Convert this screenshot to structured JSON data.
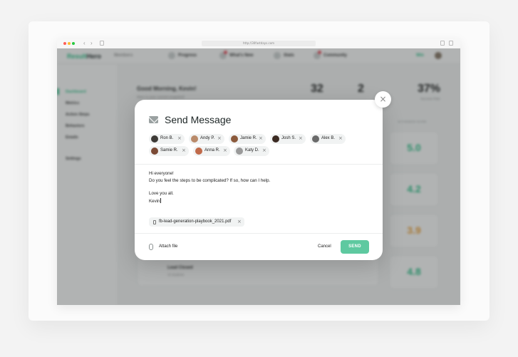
{
  "browser": {
    "url": "http://30fastdays.com",
    "traffic_colors": [
      "#ff5f57",
      "#febc2e",
      "#28c840"
    ]
  },
  "app": {
    "logo_prefix": "",
    "logo_brand": "Result",
    "logo_suffix": "Hero",
    "top_nav": [
      "Members",
      "Progress",
      "What's New",
      "Stats",
      "Community"
    ],
    "credits": "Win",
    "sidebar": [
      "Dashboard",
      "Metrics",
      "Action Steps",
      "Behaviors",
      "Emails",
      "Settings"
    ],
    "greeting": "Good Morning, Kevin!",
    "greeting_sub": "Here is your current snapshot!",
    "stats": [
      "32",
      "2",
      "37%"
    ],
    "stat_caption": "Success Rate",
    "column_header": "ACTIVENESS SCORE",
    "scores": [
      {
        "value": "5.0",
        "color": "#32c48d"
      },
      {
        "value": "4.2",
        "color": "#32c48d"
      },
      {
        "value": "3.9",
        "color": "#f0a43a"
      },
      {
        "value": "4.8",
        "color": "#32c48d"
      }
    ],
    "row_partial": "Lead Closed",
    "row_partial_sub": "10 students"
  },
  "modal": {
    "title": "Send Message",
    "recipients": [
      {
        "name": "Ron B.",
        "avatar": "#3d3a36"
      },
      {
        "name": "Andy P.",
        "avatar": "#b98a6a"
      },
      {
        "name": "Jamie R.",
        "avatar": "#8b5a3c"
      },
      {
        "name": "Josh S.",
        "avatar": "#3b2a22"
      },
      {
        "name": "Alex B.",
        "avatar": "#6a6a6a"
      },
      {
        "name": "Samie R.",
        "avatar": "#7b4a35"
      },
      {
        "name": "Anna R.",
        "avatar": "#c06a4a"
      },
      {
        "name": "Katy D.",
        "avatar": "#9a9a9a"
      }
    ],
    "message_lines": [
      "Hi everyone!",
      "Do you feel the steps to be complicated? If so, how can I help.",
      "",
      "Love you all.",
      "Kevin"
    ],
    "attachment": "fb-lead-generation-playbook_2021.pdf",
    "attach_label": "Attach file",
    "cancel_label": "Cancel",
    "send_label": "SEND",
    "send_color": "#5ec9a0"
  }
}
